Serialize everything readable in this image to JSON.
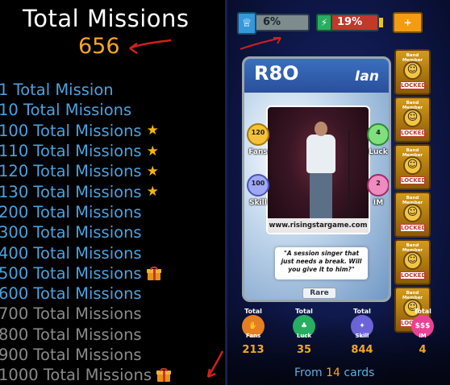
{
  "left": {
    "title": "Total Missions",
    "count": "656",
    "rows": [
      {
        "label": "1 Total Mission",
        "color": "#4aa3df",
        "reward": ""
      },
      {
        "label": "10 Total Missions",
        "color": "#4aa3df",
        "reward": ""
      },
      {
        "label": "100 Total Missions",
        "color": "#4aa3df",
        "reward": "star"
      },
      {
        "label": "110 Total Missions",
        "color": "#4aa3df",
        "reward": "star"
      },
      {
        "label": "120 Total Missions",
        "color": "#4aa3df",
        "reward": "star"
      },
      {
        "label": "130 Total Missions",
        "color": "#4aa3df",
        "reward": "star"
      },
      {
        "label": "200 Total Missions",
        "color": "#4aa3df",
        "reward": ""
      },
      {
        "label": "300 Total Missions",
        "color": "#4aa3df",
        "reward": ""
      },
      {
        "label": "400 Total Missions",
        "color": "#4aa3df",
        "reward": ""
      },
      {
        "label": "500 Total Missions",
        "color": "#4aa3df",
        "reward": "gift"
      },
      {
        "label": "600 Total Missions",
        "color": "#4aa3df",
        "reward": ""
      },
      {
        "label": "700 Total Missions",
        "color": "#8a8a8a",
        "reward": ""
      },
      {
        "label": "800 Total Missions",
        "color": "#8a8a8a",
        "reward": ""
      },
      {
        "label": "900 Total Missions",
        "color": "#8a8a8a",
        "reward": ""
      },
      {
        "label": "1000 Total Missions",
        "color": "#8a8a8a",
        "reward": "gift"
      }
    ]
  },
  "topbar": {
    "xp_text": "6%",
    "xp_progress": 0.06,
    "energy_text": "19%",
    "plus_label": "+"
  },
  "card": {
    "code": "R8O",
    "name": "Ian",
    "site": "www.risingstargame.com",
    "quote": "\"A session singer that just needs a break. Will you give it to him?\"",
    "rarity": "Rare",
    "stats": {
      "fans": {
        "value": "120",
        "label": "Fans"
      },
      "luck": {
        "value": "4",
        "label": "Luck"
      },
      "skill": {
        "value": "100",
        "label": "Skill"
      },
      "im": {
        "value": "2",
        "label": "IM"
      }
    }
  },
  "band_slots": [
    {
      "title": "Band Member",
      "status": "LOCKED"
    },
    {
      "title": "Band Member",
      "status": "LOCKED"
    },
    {
      "title": "Band Member",
      "status": "LOCKED"
    },
    {
      "title": "Band Member",
      "status": "LOCKED"
    },
    {
      "title": "Band Member",
      "status": "LOCKED"
    },
    {
      "title": "Band Member",
      "status": "LOCKED"
    }
  ],
  "totals": {
    "fans": {
      "label": "Total",
      "sub": "Fans",
      "value": "213"
    },
    "luck": {
      "label": "Total",
      "sub": "Luck",
      "value": "35"
    },
    "skill": {
      "label": "Total",
      "sub": "Skill",
      "value": "844"
    },
    "im": {
      "label": "Total",
      "sub": "IM",
      "value": "4"
    }
  },
  "footer": {
    "prefix": "From",
    "count": "14",
    "suffix": "cards"
  }
}
